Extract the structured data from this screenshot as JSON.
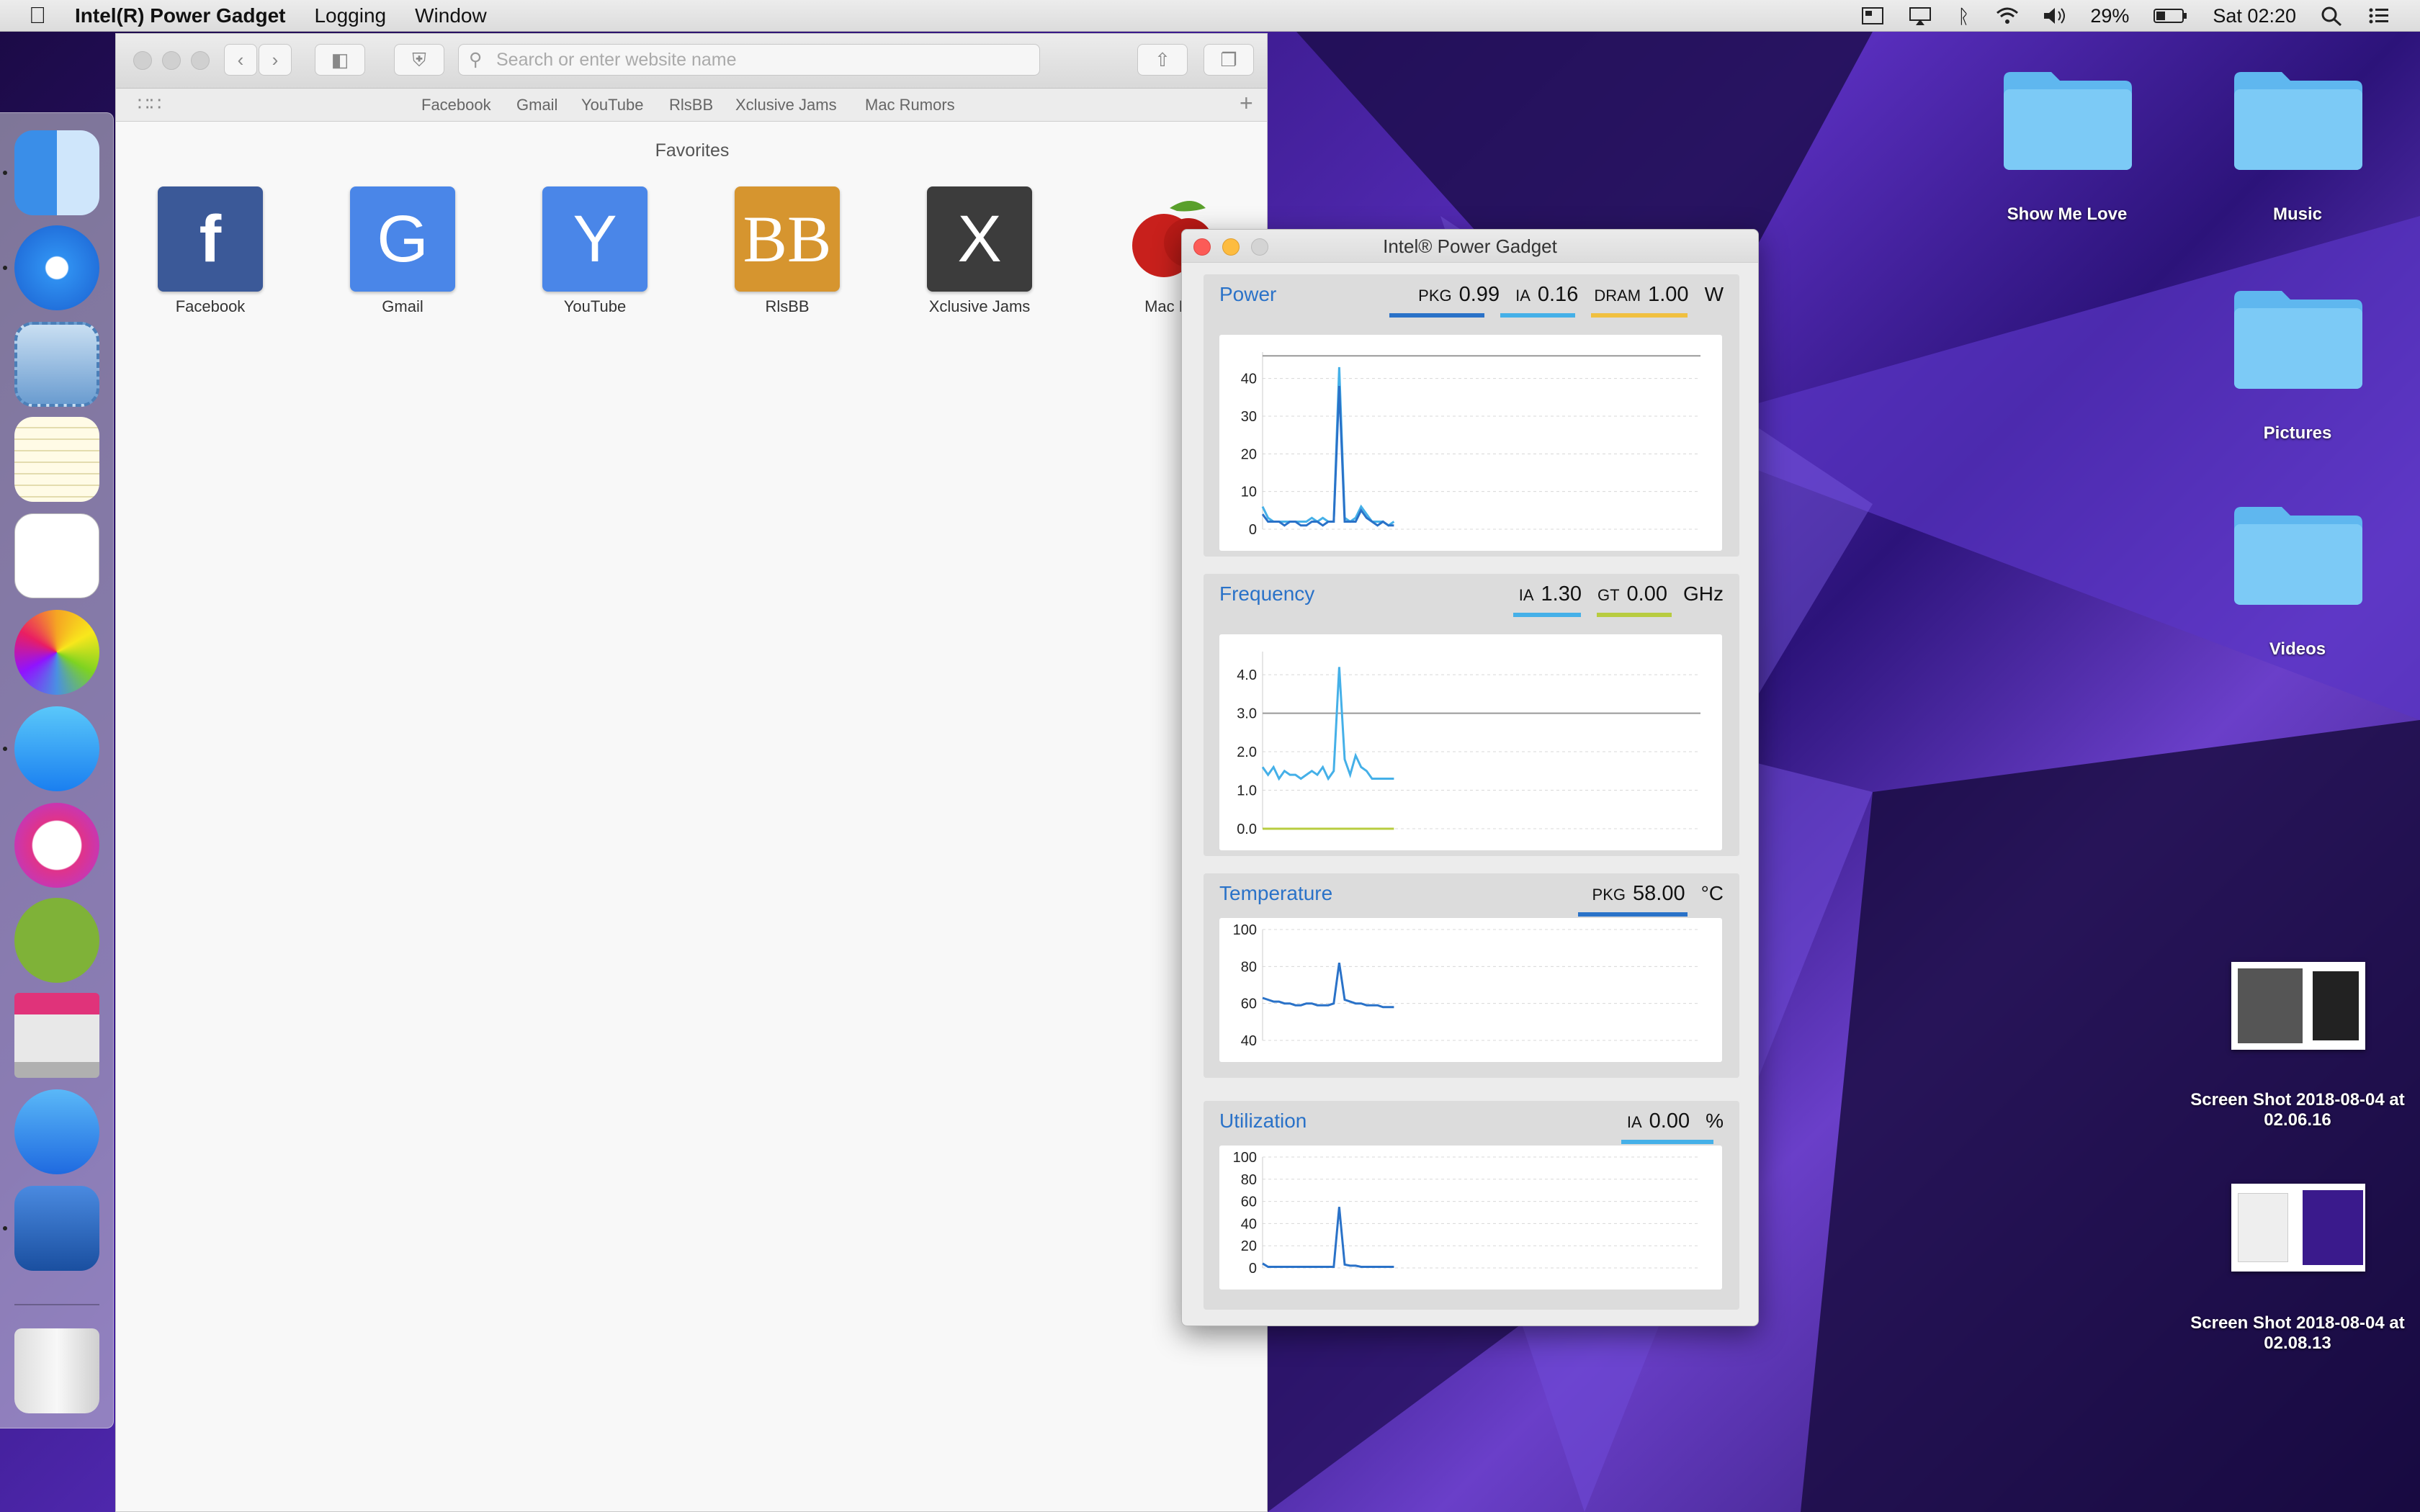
{
  "menubar": {
    "app_name": "Intel(R) Power Gadget",
    "menus": [
      "Logging",
      "Window"
    ],
    "battery": "29%",
    "clock": "Sat 02:20"
  },
  "safari": {
    "search_placeholder": "Search or enter website name",
    "favorites_bar": [
      "Facebook",
      "Gmail",
      "YouTube",
      "RlsBB",
      "Xclusive Jams",
      "Mac Rumors"
    ],
    "favorites_heading": "Favorites",
    "tiles": [
      {
        "label": "Facebook",
        "glyph": "f",
        "color": "#3b5998"
      },
      {
        "label": "Gmail",
        "glyph": "G",
        "color": "#4a86e8"
      },
      {
        "label": "YouTube",
        "glyph": "Y",
        "color": "#4a86e8"
      },
      {
        "label": "RlsBB",
        "glyph": "BB",
        "color": "#d6952f"
      },
      {
        "label": "Xclusive Jams",
        "glyph": "X",
        "color": "#3c3c3c"
      },
      {
        "label": "Mac Ru",
        "glyph": "",
        "color": "#ffffff"
      }
    ]
  },
  "gadget": {
    "title": "Intel® Power Gadget",
    "power": {
      "title": "Power",
      "readouts": [
        {
          "label": "PKG",
          "value": "0.99",
          "color": "#2a72c8"
        },
        {
          "label": "IA",
          "value": "0.16",
          "color": "#45b0e8"
        },
        {
          "label": "DRAM",
          "value": "1.00",
          "color": "#f0c040"
        }
      ],
      "unit": "W"
    },
    "frequency": {
      "title": "Frequency",
      "readouts": [
        {
          "label": "IA",
          "value": "1.30",
          "color": "#45b0e8"
        },
        {
          "label": "GT",
          "value": "0.00",
          "color": "#b8cc40"
        }
      ],
      "unit": "GHz"
    },
    "temperature": {
      "title": "Temperature",
      "readouts": [
        {
          "label": "PKG",
          "value": "58.00",
          "color": "#2a72c8"
        }
      ],
      "unit": "°C"
    },
    "utilization": {
      "title": "Utilization",
      "readouts": [
        {
          "label": "IA",
          "value": "0.00",
          "color": "#45b0e8"
        }
      ],
      "unit": "%"
    }
  },
  "chart_data": [
    {
      "type": "line",
      "name": "power",
      "yticks": [
        "40",
        "30",
        "20",
        "10",
        "0"
      ],
      "ylim": [
        0,
        47
      ],
      "grid": true,
      "series": [
        {
          "color": "#45b0e8",
          "values": [
            6,
            3,
            2,
            2,
            2,
            2,
            2,
            2,
            2,
            3,
            2,
            3,
            2,
            2,
            43,
            3,
            2,
            3,
            6,
            4,
            2,
            2,
            2,
            1,
            2
          ]
        },
        {
          "color": "#2a72c8",
          "values": [
            4,
            2,
            2,
            2,
            1,
            2,
            2,
            1,
            1,
            2,
            2,
            1,
            2,
            2,
            38,
            2,
            2,
            2,
            5,
            3,
            2,
            1,
            2,
            1,
            1
          ]
        }
      ],
      "reference_line": 46
    },
    {
      "type": "line",
      "name": "frequency",
      "yticks": [
        "4.0",
        "3.0",
        "2.0",
        "1.0",
        "0.0"
      ],
      "ylim": [
        0,
        4.6
      ],
      "grid": true,
      "series": [
        {
          "color": "#45b0e8",
          "values": [
            1.6,
            1.4,
            1.6,
            1.3,
            1.5,
            1.4,
            1.4,
            1.3,
            1.4,
            1.5,
            1.4,
            1.6,
            1.3,
            1.5,
            4.2,
            1.8,
            1.4,
            1.9,
            1.6,
            1.5,
            1.3,
            1.3,
            1.3,
            1.3,
            1.3
          ]
        },
        {
          "color": "#b8cc40",
          "values": [
            0,
            0,
            0,
            0,
            0,
            0,
            0,
            0,
            0,
            0,
            0,
            0,
            0,
            0,
            0,
            0,
            0,
            0,
            0,
            0,
            0,
            0,
            0,
            0,
            0
          ]
        }
      ],
      "reference_line": 3.0
    },
    {
      "type": "line",
      "name": "temperature",
      "yticks": [
        "100",
        "80",
        "60",
        "40"
      ],
      "ylim": [
        40,
        100
      ],
      "grid": true,
      "series": [
        {
          "color": "#2a72c8",
          "values": [
            63,
            62,
            61,
            61,
            60,
            60,
            59,
            59,
            60,
            60,
            59,
            59,
            59,
            60,
            82,
            62,
            61,
            60,
            60,
            59,
            59,
            59,
            58,
            58,
            58
          ]
        }
      ]
    },
    {
      "type": "line",
      "name": "utilization",
      "yticks": [
        "100",
        "80",
        "60",
        "40",
        "20",
        "0"
      ],
      "ylim": [
        0,
        100
      ],
      "grid": true,
      "series": [
        {
          "color": "#2a72c8",
          "values": [
            4,
            1,
            1,
            1,
            1,
            1,
            1,
            1,
            1,
            1,
            1,
            1,
            1,
            1,
            55,
            3,
            2,
            2,
            1,
            1,
            1,
            1,
            1,
            1,
            1
          ]
        }
      ]
    }
  ],
  "desktop_icons": [
    "Show Me Love",
    "Music",
    "Pictures",
    "Videos",
    "Screen Shot 2018-08-04 at 02.06.16",
    "Screen Shot 2018-08-04 at 02.08.13"
  ]
}
